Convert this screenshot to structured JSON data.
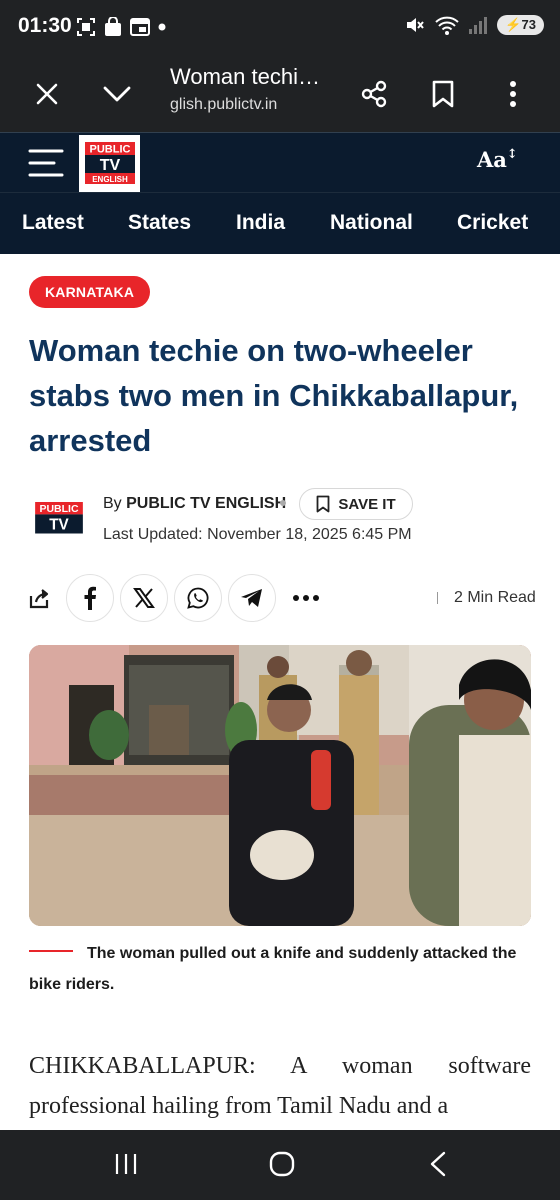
{
  "status_bar": {
    "time": "01:30",
    "battery": "73",
    "icons": [
      "screenshot-icon",
      "shopping-bag-icon",
      "window-icon",
      "notification-dot-icon",
      "mute-icon",
      "wifi-icon",
      "signal-icon",
      "battery-icon"
    ]
  },
  "browser": {
    "title": "Woman techi…",
    "domain": "glish.publictv.in",
    "close_icon": "close-icon",
    "expand_icon": "chevron-down-icon",
    "share_icon": "share-icon",
    "bookmark_icon": "bookmark-icon",
    "menu_icon": "more-vertical-icon"
  },
  "site": {
    "logo_line1": "PUBLIC",
    "logo_line2": "TV",
    "logo_line3": "ENGLISH",
    "font_size_label": "Aa",
    "font_size_arrow": "↕",
    "brand_red": "#e8252a",
    "header_bg": "#0b1b2e"
  },
  "nav": {
    "items": [
      "Latest",
      "States",
      "India",
      "National",
      "Cricket"
    ]
  },
  "article": {
    "category": "KARNATAKA",
    "headline": "Woman techie on two-wheeler stabs two men in Chikkaballapur, arrested",
    "by_prefix": "By",
    "author": "PUBLIC TV ENGLISH",
    "save_label": "SAVE IT",
    "last_updated": "Last Updated: November 18, 2025 6:45 PM",
    "read_time": "2 Min Read",
    "caption": "The woman pulled out a knife and suddenly attacked the bike riders.",
    "body": "CHIKKABALLAPUR: A woman software professional hailing from Tamil Nadu and a"
  },
  "share": {
    "icons": [
      "share-arrow-icon",
      "facebook-icon",
      "x-icon",
      "whatsapp-icon",
      "telegram-icon",
      "more-horizontal-icon"
    ]
  },
  "bottom_nav": {
    "icons": [
      "recents-icon",
      "home-icon",
      "back-icon"
    ]
  }
}
